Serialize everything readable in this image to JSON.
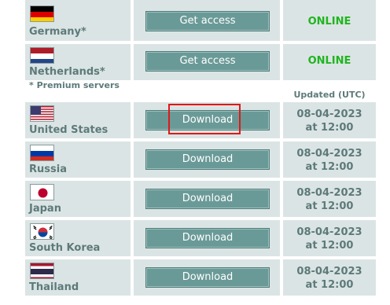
{
  "premium_rows": [
    {
      "country": "Germany*",
      "flag": "germany-flag",
      "button": "Get access",
      "status": "ONLINE"
    },
    {
      "country": "Netherlands*",
      "flag": "netherlands-flag",
      "button": "Get access",
      "status": "ONLINE"
    }
  ],
  "premium_note": "* Premium servers",
  "updated_header": "Updated (UTC)",
  "free_rows": [
    {
      "country": "United States",
      "flag": "usa-flag",
      "button": "Download",
      "date": "08-04-2023",
      "time": "at 12:00"
    },
    {
      "country": "Russia",
      "flag": "russia-flag",
      "button": "Download",
      "date": "08-04-2023",
      "time": "at 12:00"
    },
    {
      "country": "Japan",
      "flag": "japan-flag",
      "button": "Download",
      "date": "08-04-2023",
      "time": "at 12:00"
    },
    {
      "country": "South Korea",
      "flag": "south-korea-flag",
      "button": "Download",
      "date": "08-04-2023",
      "time": "at 12:00"
    },
    {
      "country": "Thailand",
      "flag": "thailand-flag",
      "button": "Download",
      "date": "08-04-2023",
      "time": "at 12:00"
    }
  ],
  "colors": {
    "cell_bg": "#dbe4e4",
    "button_bg": "#6a9a97",
    "online": "#1fb51f",
    "text": "#5d7a7a",
    "highlight": "#e01818"
  }
}
